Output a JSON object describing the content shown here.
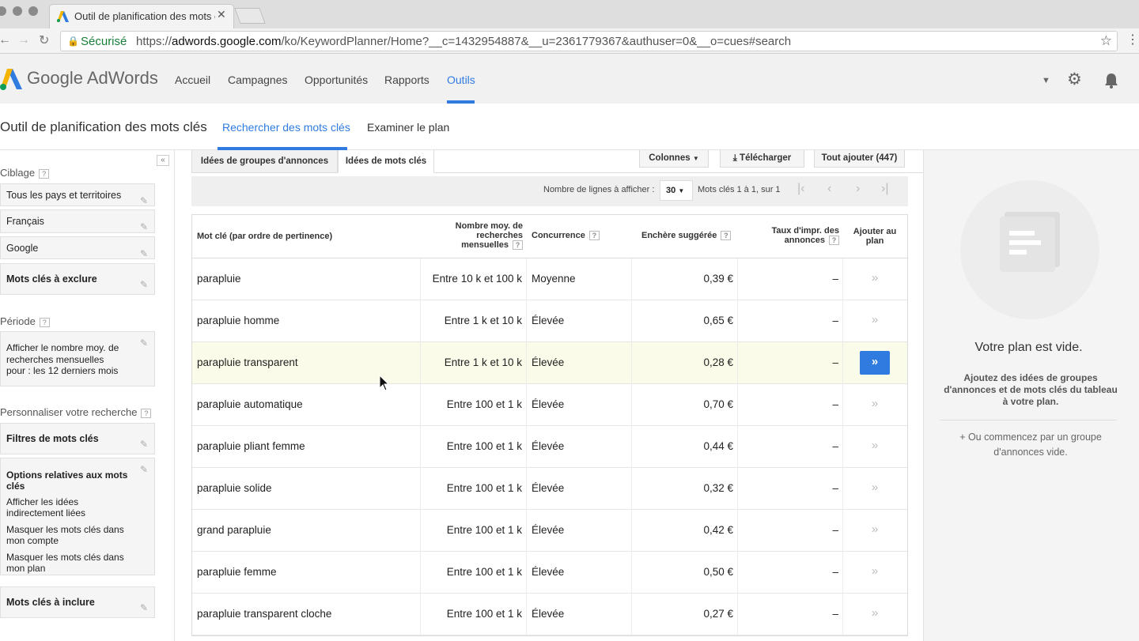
{
  "browser": {
    "tab_title": "Outil de planification des mots clés",
    "secure_label": "Sécurisé",
    "url_scheme": "https://",
    "url_domain": "adwords.google.com",
    "url_path": "/ko/KeywordPlanner/Home?__c=1432954887&__u=2361779367&authuser=0&__o=cues#search"
  },
  "header": {
    "brand": "Google AdWords",
    "nav": [
      "Accueil",
      "Campagnes",
      "Opportunités",
      "Rapports",
      "Outils"
    ],
    "active_nav": "Outils"
  },
  "subheader": {
    "title": "Outil de planification des mots clés",
    "tab_search": "Rechercher des mots clés",
    "tab_review": "Examiner le plan"
  },
  "sidebar": {
    "collapse_label": "«",
    "targeting_title": "Ciblage",
    "targeting_items": [
      "Tous les pays et territoires",
      "Français",
      "Google"
    ],
    "negative_keywords": "Mots clés à exclure",
    "period_title": "Période",
    "period_text": "Afficher le nombre moy. de recherches mensuelles pour : les 12 derniers mois",
    "customize_title": "Personnaliser votre recherche",
    "keyword_filters": "Filtres de mots clés",
    "keyword_options_title": "Options relatives aux mots clés",
    "keyword_options": [
      "Afficher les idées indirectement liées",
      "Masquer les mots clés dans mon compte",
      "Masquer les mots clés dans mon plan"
    ],
    "include_keywords": "Mots clés à inclure"
  },
  "results": {
    "tab_groups": "Idées de groupes d'annonces",
    "tab_keywords": "Idées de mots clés",
    "columns_btn": "Colonnes",
    "download_btn": "Télécharger",
    "add_all_btn": "Tout ajouter (447)",
    "rows_label": "Nombre de lignes à afficher :",
    "rows_value": "30",
    "range_text": "Mots clés 1 à 1, sur 1",
    "headers": {
      "keyword": "Mot clé (par ordre de pertinence)",
      "searches": "Nombre moy. de recherches mensuelles",
      "competition": "Concurrence",
      "bid": "Enchère suggérée",
      "impr": "Taux d'impr. des annonces",
      "add": "Ajouter au plan"
    },
    "rows": [
      {
        "keyword": "parapluie",
        "searches": "Entre 10 k et 100 k",
        "competition": "Moyenne",
        "bid": "0,39 €",
        "impr": "–"
      },
      {
        "keyword": "parapluie homme",
        "searches": "Entre 1 k et 10 k",
        "competition": "Élevée",
        "bid": "0,65 €",
        "impr": "–"
      },
      {
        "keyword": "parapluie transparent",
        "searches": "Entre 1 k et 10 k",
        "competition": "Élevée",
        "bid": "0,28 €",
        "impr": "–"
      },
      {
        "keyword": "parapluie automatique",
        "searches": "Entre 100 et 1 k",
        "competition": "Élevée",
        "bid": "0,70 €",
        "impr": "–"
      },
      {
        "keyword": "parapluie pliant femme",
        "searches": "Entre 100 et 1 k",
        "competition": "Élevée",
        "bid": "0,44 €",
        "impr": "–"
      },
      {
        "keyword": "parapluie solide",
        "searches": "Entre 100 et 1 k",
        "competition": "Élevée",
        "bid": "0,32 €",
        "impr": "–"
      },
      {
        "keyword": "grand parapluie",
        "searches": "Entre 100 et 1 k",
        "competition": "Élevée",
        "bid": "0,42 €",
        "impr": "–"
      },
      {
        "keyword": "parapluie femme",
        "searches": "Entre 100 et 1 k",
        "competition": "Élevée",
        "bid": "0,50 €",
        "impr": "–"
      },
      {
        "keyword": "parapluie transparent cloche",
        "searches": "Entre 100 et 1 k",
        "competition": "Élevée",
        "bid": "0,27 €",
        "impr": "–"
      }
    ],
    "add_symbol": "»"
  },
  "plan": {
    "empty_title": "Votre plan est vide.",
    "help": "Ajoutez des idées de groupes d'annonces et de mots clés du tableau à votre plan.",
    "or_text": "+ Ou commencez par un groupe d'annonces vide."
  },
  "colors": {
    "accent": "#2f7be0",
    "secure": "#188038",
    "highlight_row": "#fbfbe9"
  }
}
